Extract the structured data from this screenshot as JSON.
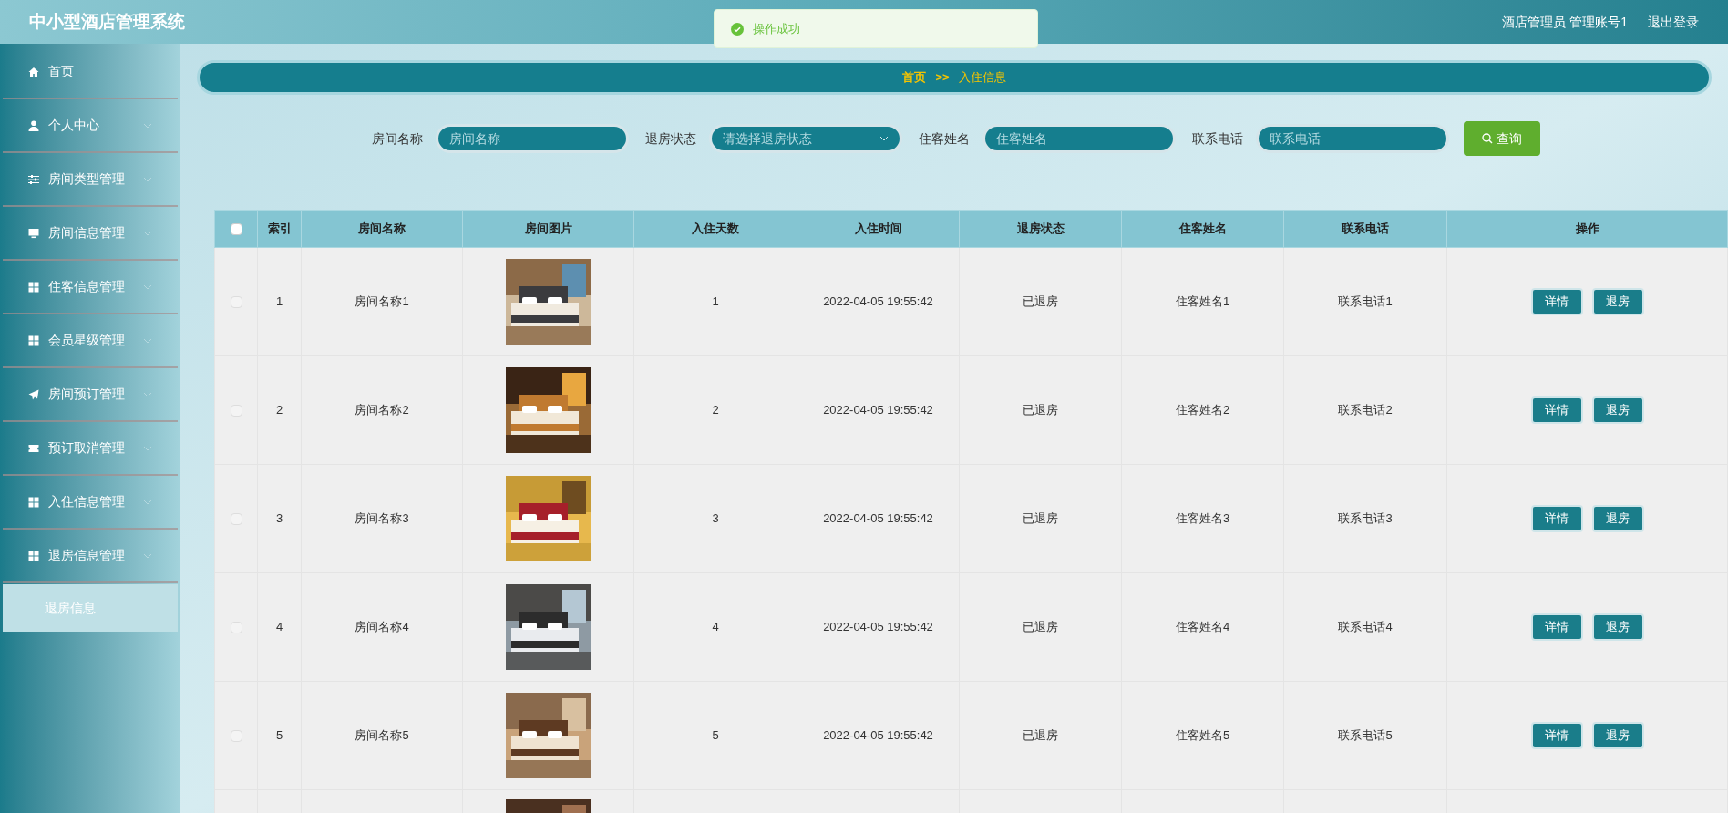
{
  "header": {
    "title": "中小型酒店管理系统",
    "user": "酒店管理员 管理账号1",
    "logout": "退出登录"
  },
  "toast": {
    "message": "操作成功"
  },
  "sidebar": {
    "items": [
      {
        "label": "首页",
        "kind": "link"
      },
      {
        "label": "个人中心",
        "kind": "menu"
      },
      {
        "label": "房间类型管理",
        "kind": "menu"
      },
      {
        "label": "房间信息管理",
        "kind": "menu"
      },
      {
        "label": "住客信息管理",
        "kind": "menu"
      },
      {
        "label": "会员星级管理",
        "kind": "menu"
      },
      {
        "label": "房间预订管理",
        "kind": "menu"
      },
      {
        "label": "预订取消管理",
        "kind": "menu"
      },
      {
        "label": "入住信息管理",
        "kind": "menu"
      },
      {
        "label": "退房信息管理",
        "kind": "menu",
        "children": [
          {
            "label": "退房信息",
            "selected": true
          }
        ]
      }
    ]
  },
  "breadcrumb": {
    "home": "首页",
    "separator": ">>",
    "current": "入住信息"
  },
  "search": {
    "fields": [
      {
        "label": "房间名称",
        "kind": "text",
        "placeholder": "房间名称"
      },
      {
        "label": "退房状态",
        "kind": "select",
        "placeholder": "请选择退房状态"
      },
      {
        "label": "住客姓名",
        "kind": "text",
        "placeholder": "住客姓名"
      },
      {
        "label": "联系电话",
        "kind": "text",
        "placeholder": "联系电话"
      }
    ],
    "button": "查询"
  },
  "table": {
    "select_all_checked": false,
    "columns": [
      "索引",
      "房间名称",
      "房间图片",
      "入住天数",
      "入住时间",
      "退房状态",
      "住客姓名",
      "联系电话",
      "操作"
    ],
    "rows": [
      {
        "checked": false,
        "index": "1",
        "room_name": "房间名称1",
        "days": "1",
        "checkin_time": "2022-04-05 19:55:42",
        "status": "已退房",
        "guest": "住客姓名1",
        "phone": "联系电话1",
        "actions": [
          "详情",
          "退房"
        ]
      },
      {
        "checked": false,
        "index": "2",
        "room_name": "房间名称2",
        "days": "2",
        "checkin_time": "2022-04-05 19:55:42",
        "status": "已退房",
        "guest": "住客姓名2",
        "phone": "联系电话2",
        "actions": [
          "详情",
          "退房"
        ]
      },
      {
        "checked": false,
        "index": "3",
        "room_name": "房间名称3",
        "days": "3",
        "checkin_time": "2022-04-05 19:55:42",
        "status": "已退房",
        "guest": "住客姓名3",
        "phone": "联系电话3",
        "actions": [
          "详情",
          "退房"
        ]
      },
      {
        "checked": false,
        "index": "4",
        "room_name": "房间名称4",
        "days": "4",
        "checkin_time": "2022-04-05 19:55:42",
        "status": "已退房",
        "guest": "住客姓名4",
        "phone": "联系电话4",
        "actions": [
          "详情",
          "退房"
        ]
      },
      {
        "checked": false,
        "index": "5",
        "room_name": "房间名称5",
        "days": "5",
        "checkin_time": "2022-04-05 19:55:42",
        "status": "已退房",
        "guest": "住客姓名5",
        "phone": "联系电话5",
        "actions": [
          "详情",
          "退房"
        ]
      },
      {
        "partial": true
      }
    ]
  }
}
